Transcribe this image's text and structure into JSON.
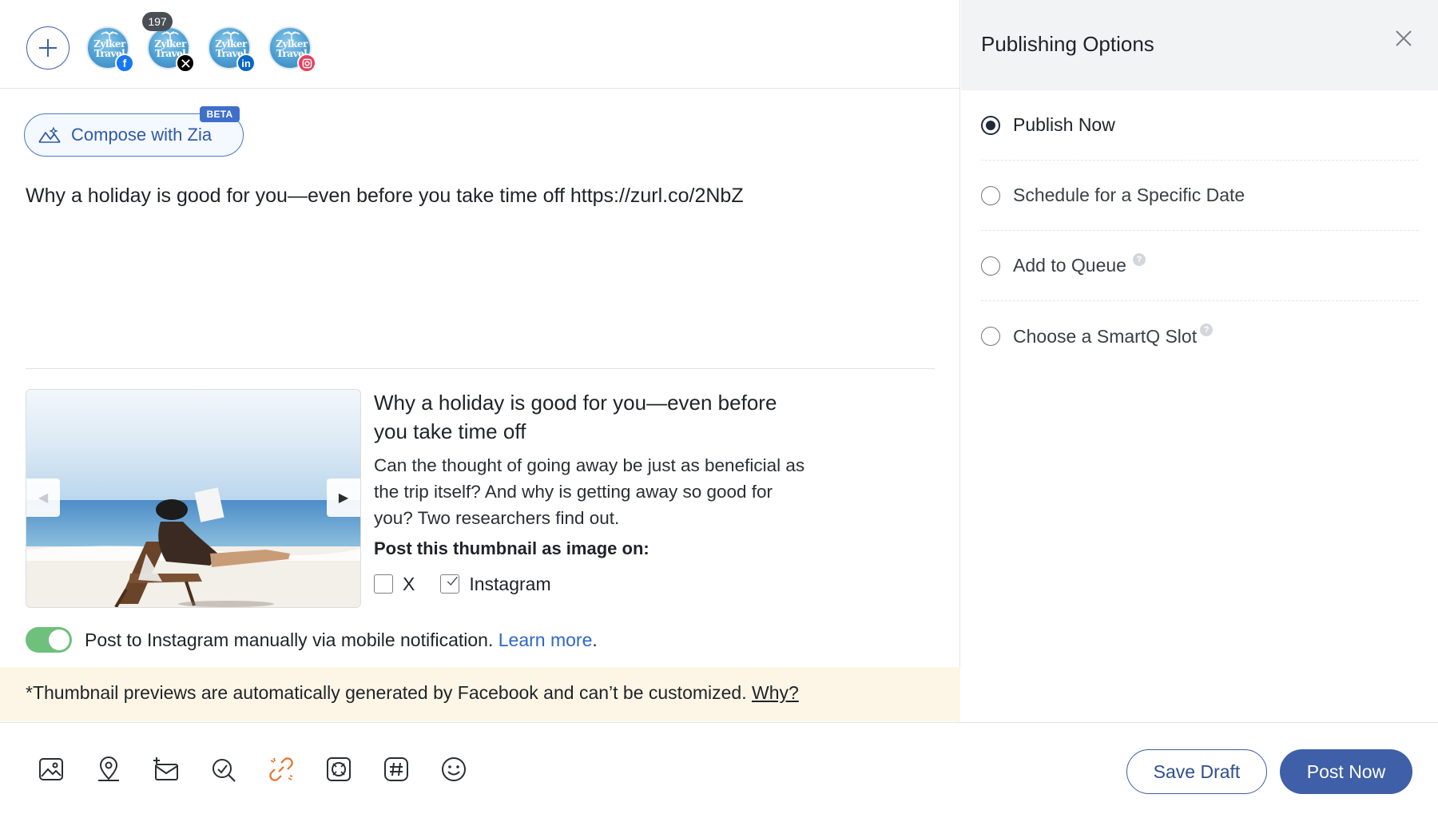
{
  "accounts": {
    "add_icon": "plus-icon",
    "items": [
      {
        "name": "Zylker Travel",
        "logo_text": "Zylker\nTravel",
        "network": "facebook",
        "network_color": "#1877f2"
      },
      {
        "name": "Zylker Travel",
        "logo_text": "Zylker\nTravel",
        "network": "x",
        "network_color": "#000000",
        "badge": "197"
      },
      {
        "name": "Zylker Travel",
        "logo_text": "Zylker\nTravel",
        "network": "linkedin",
        "network_color": "#0a66c2"
      },
      {
        "name": "Zylker Travel",
        "logo_text": "Zylker\nTravel",
        "network": "instagram",
        "network_color": "#e4405f"
      }
    ]
  },
  "composer": {
    "zia_label": "Compose with Zia",
    "zia_badge": "BETA",
    "post_text": "Why a holiday is good for you—even before you take time off https://zurl.co/2NbZ"
  },
  "link_preview": {
    "title": "Why a holiday is good for you—even before you take time off",
    "description": "Can the thought of going away be just as beneficial as the trip itself? And why is getting away so good for you? Two researchers find out.",
    "thumbnail_label": "Post this thumbnail as image on:",
    "options": [
      {
        "label": "X",
        "checked": false
      },
      {
        "label": "Instagram",
        "checked": true
      }
    ]
  },
  "instagram_toggle": {
    "on": true,
    "text": "Post to Instagram manually via mobile notification.",
    "link": "Learn more",
    "suffix": "."
  },
  "notice": {
    "text": "*Thumbnail previews are automatically generated by Facebook and can’t be customized.",
    "link": "Why?"
  },
  "publishing": {
    "title": "Publishing Options",
    "close_icon": "close-icon",
    "options": [
      {
        "label": "Publish Now",
        "selected": true,
        "help": false
      },
      {
        "label": "Schedule for a Specific Date",
        "selected": false,
        "help": false
      },
      {
        "label": "Add to Queue",
        "selected": false,
        "help": true
      },
      {
        "label": "Choose a SmartQ Slot",
        "selected": false,
        "help": true
      }
    ],
    "help_glyph": "?"
  },
  "toolbar": {
    "tools": [
      "image-icon",
      "location-icon",
      "add-mail-icon",
      "tag-search-icon",
      "link-shortener-icon",
      "photo-filter-icon",
      "hashtag-icon",
      "emoji-icon"
    ],
    "accent_color": "#e8742a",
    "save_draft": "Save Draft",
    "post_now": "Post Now"
  },
  "colors": {
    "primary": "#3f5fa8",
    "toggle_on": "#6ec07c",
    "notice_bg": "#fdf6e6",
    "link": "#2f66c9"
  }
}
